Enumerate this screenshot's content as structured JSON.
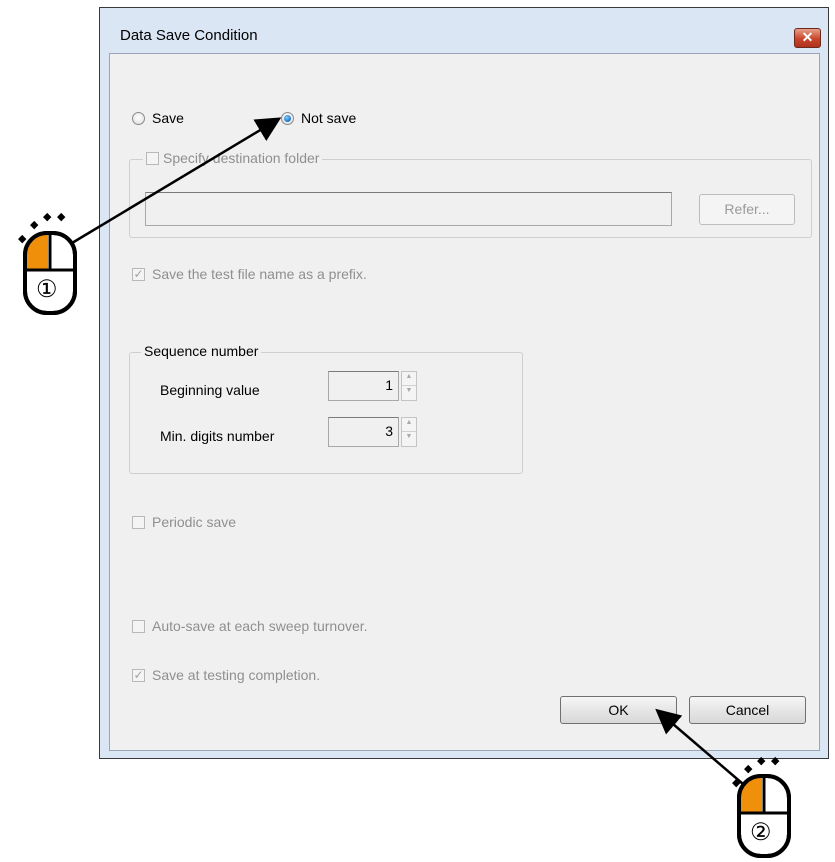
{
  "dialog": {
    "title": "Data Save Condition",
    "close_glyph": "✕"
  },
  "save_mode": {
    "save_label": "Save",
    "not_save_label": "Not save",
    "selected": "Not save"
  },
  "destination": {
    "checkbox_label": "Specify destination folder",
    "checked": false,
    "path_value": "",
    "refer_label": "Refer..."
  },
  "prefix": {
    "label": "Save the test file name as a prefix.",
    "checked": true
  },
  "sequence": {
    "legend": "Sequence number",
    "beginning_label": "Beginning value",
    "beginning_value": "1",
    "digits_label": "Min. digits number",
    "digits_value": "3"
  },
  "periodic": {
    "label": "Periodic save",
    "checked": false
  },
  "autosave": {
    "label": "Auto-save at each sweep turnover.",
    "checked": false
  },
  "completion": {
    "label": "Save at testing completion.",
    "checked": true
  },
  "buttons": {
    "ok_label": "OK",
    "cancel_label": "Cancel"
  },
  "annotations": {
    "step1": "①",
    "step2": "②",
    "mouse_color": "#f0900a",
    "icon": "mouse-left-click-icon"
  },
  "glyphs": {
    "check": "✓",
    "spin_up": "▲",
    "spin_down": "▼",
    "sparkle": "◆"
  }
}
